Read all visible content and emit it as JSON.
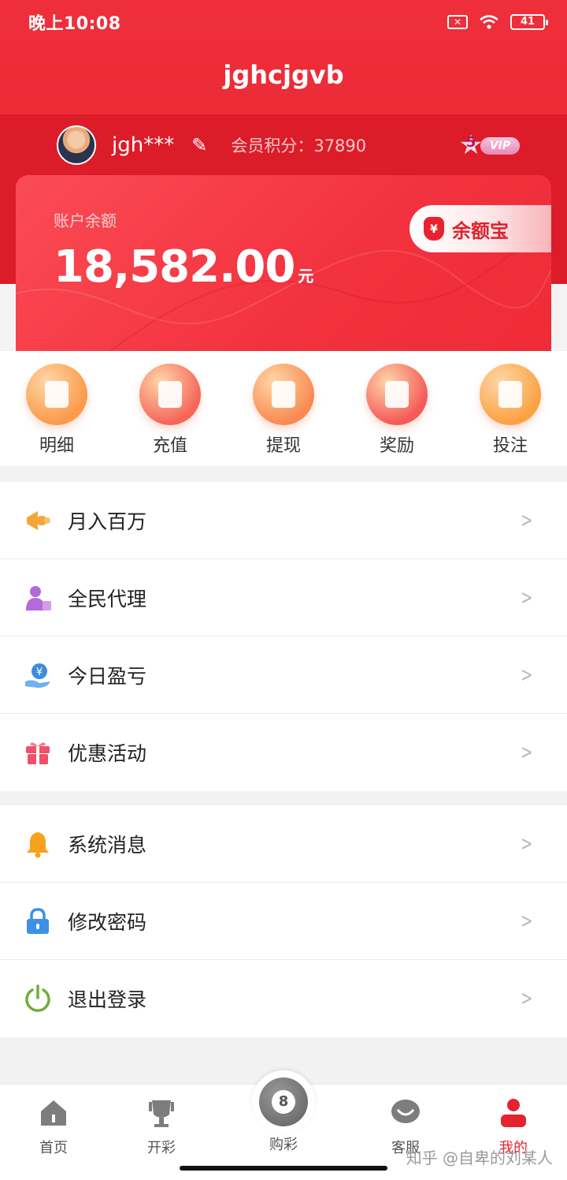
{
  "status_bar": {
    "time": "晚上10:08",
    "battery": "41"
  },
  "header": {
    "title": "jghcjgvb"
  },
  "user": {
    "name": "jgh***",
    "points_label": "会员积分：",
    "points_value": "37890",
    "vip_level": "5",
    "vip_text": "VIP"
  },
  "balance": {
    "label": "账户余额",
    "amount": "18,582.00",
    "unit": "元",
    "yuebao_label": "余额宝",
    "yuebao_icon_text": "¥"
  },
  "quick_actions": [
    {
      "label": "明细",
      "color": "#fb9a4a"
    },
    {
      "label": "充值",
      "color": "#f5665a"
    },
    {
      "label": "提现",
      "color": "#f98a52"
    },
    {
      "label": "奖励",
      "color": "#f45a58"
    },
    {
      "label": "投注",
      "color": "#fca243"
    }
  ],
  "menu_group_1": [
    {
      "label": "月入百万",
      "icon": "megaphone-icon",
      "color": "#f6a53b"
    },
    {
      "label": "全民代理",
      "icon": "agent-user-icon",
      "color": "#b46ad8"
    },
    {
      "label": "今日盈亏",
      "icon": "profit-hand-icon",
      "color": "#3c8de0"
    },
    {
      "label": "优惠活动",
      "icon": "gift-icon",
      "color": "#f0506a"
    }
  ],
  "menu_group_2": [
    {
      "label": "系统消息",
      "icon": "bell-icon",
      "color": "#f7a21c"
    },
    {
      "label": "修改密码",
      "icon": "lock-icon",
      "color": "#3d90e6"
    },
    {
      "label": "退出登录",
      "icon": "power-icon",
      "color": "#6fae3a"
    }
  ],
  "tabs": {
    "home": "首页",
    "draw": "开彩",
    "buy": "购彩",
    "buy_icon_text": "8",
    "service": "客服",
    "mine": "我的"
  },
  "watermark": "知乎 @自卑的刘某人"
}
